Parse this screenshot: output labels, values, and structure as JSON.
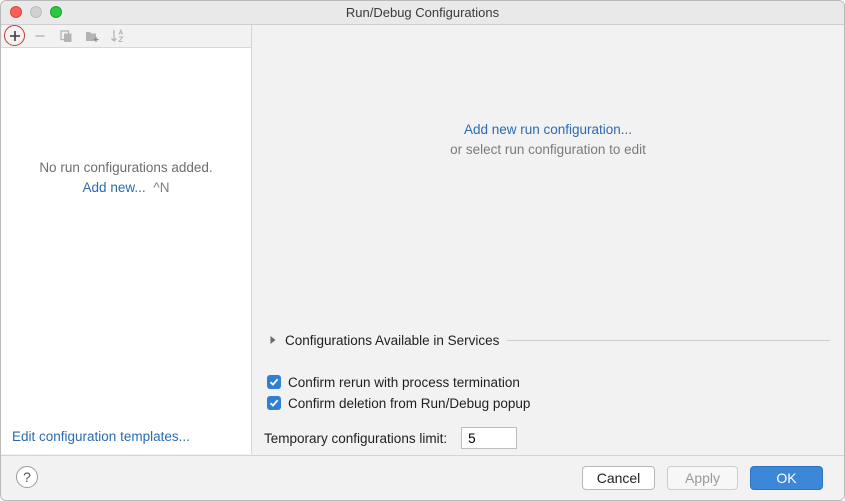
{
  "window": {
    "title": "Run/Debug Configurations"
  },
  "toolbar": {
    "add_icon": "plus-icon",
    "remove_icon": "minus-icon",
    "copy_icon": "copy-icon",
    "folder_icon": "new-folder-icon",
    "sort_icon": "sort-icon"
  },
  "left_panel": {
    "empty_message": "No run configurations added.",
    "add_new_link": "Add new...",
    "add_new_shortcut": "^N",
    "edit_templates_link": "Edit configuration templates..."
  },
  "right_panel": {
    "add_run_link": "Add new run configuration...",
    "or_select_text": "or select run configuration to edit",
    "services_label": "Configurations Available in Services",
    "confirm_rerun_label": "Confirm rerun with process termination",
    "confirm_rerun_checked": true,
    "confirm_deletion_label": "Confirm deletion from Run/Debug popup",
    "confirm_deletion_checked": true,
    "temp_limit_label": "Temporary configurations limit:",
    "temp_limit_value": "5"
  },
  "footer": {
    "help_label": "?",
    "cancel_label": "Cancel",
    "apply_label": "Apply",
    "ok_label": "OK"
  },
  "colors": {
    "link": "#2a6bb0",
    "accent": "#3c87d7",
    "checkbox": "#2f7fd3"
  }
}
